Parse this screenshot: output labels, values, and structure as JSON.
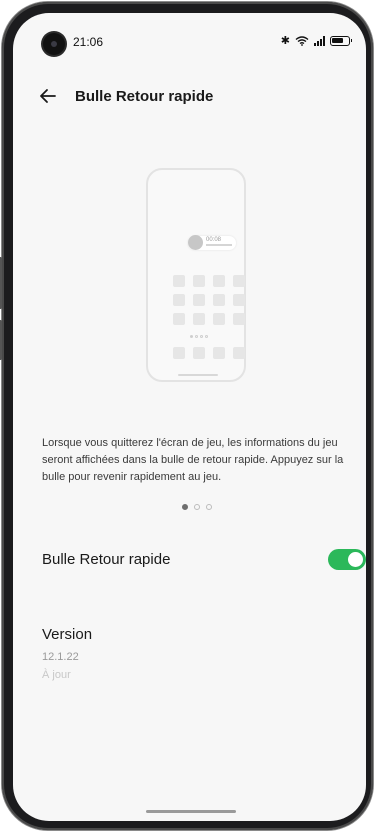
{
  "status_bar": {
    "time": "21:06",
    "icons": [
      "bluetooth-icon",
      "wifi-icon",
      "signal-icon",
      "battery-icon"
    ]
  },
  "header": {
    "back_icon": "arrow-left-icon",
    "title": "Bulle Retour rapide"
  },
  "illustration": {
    "bubble_text": "00:08"
  },
  "description": "Lorsque vous quitterez l'écran de jeu, les informations du jeu seront affichées dans la bulle de retour rapide. Appuyez sur la bulle pour revenir rapidement au jeu.",
  "pager": {
    "count": 3,
    "active_index": 0
  },
  "toggle": {
    "label": "Bulle Retour rapide",
    "on": true,
    "color": "#2bb85a"
  },
  "version": {
    "title": "Version",
    "number": "12.1.22",
    "status": "À jour"
  }
}
